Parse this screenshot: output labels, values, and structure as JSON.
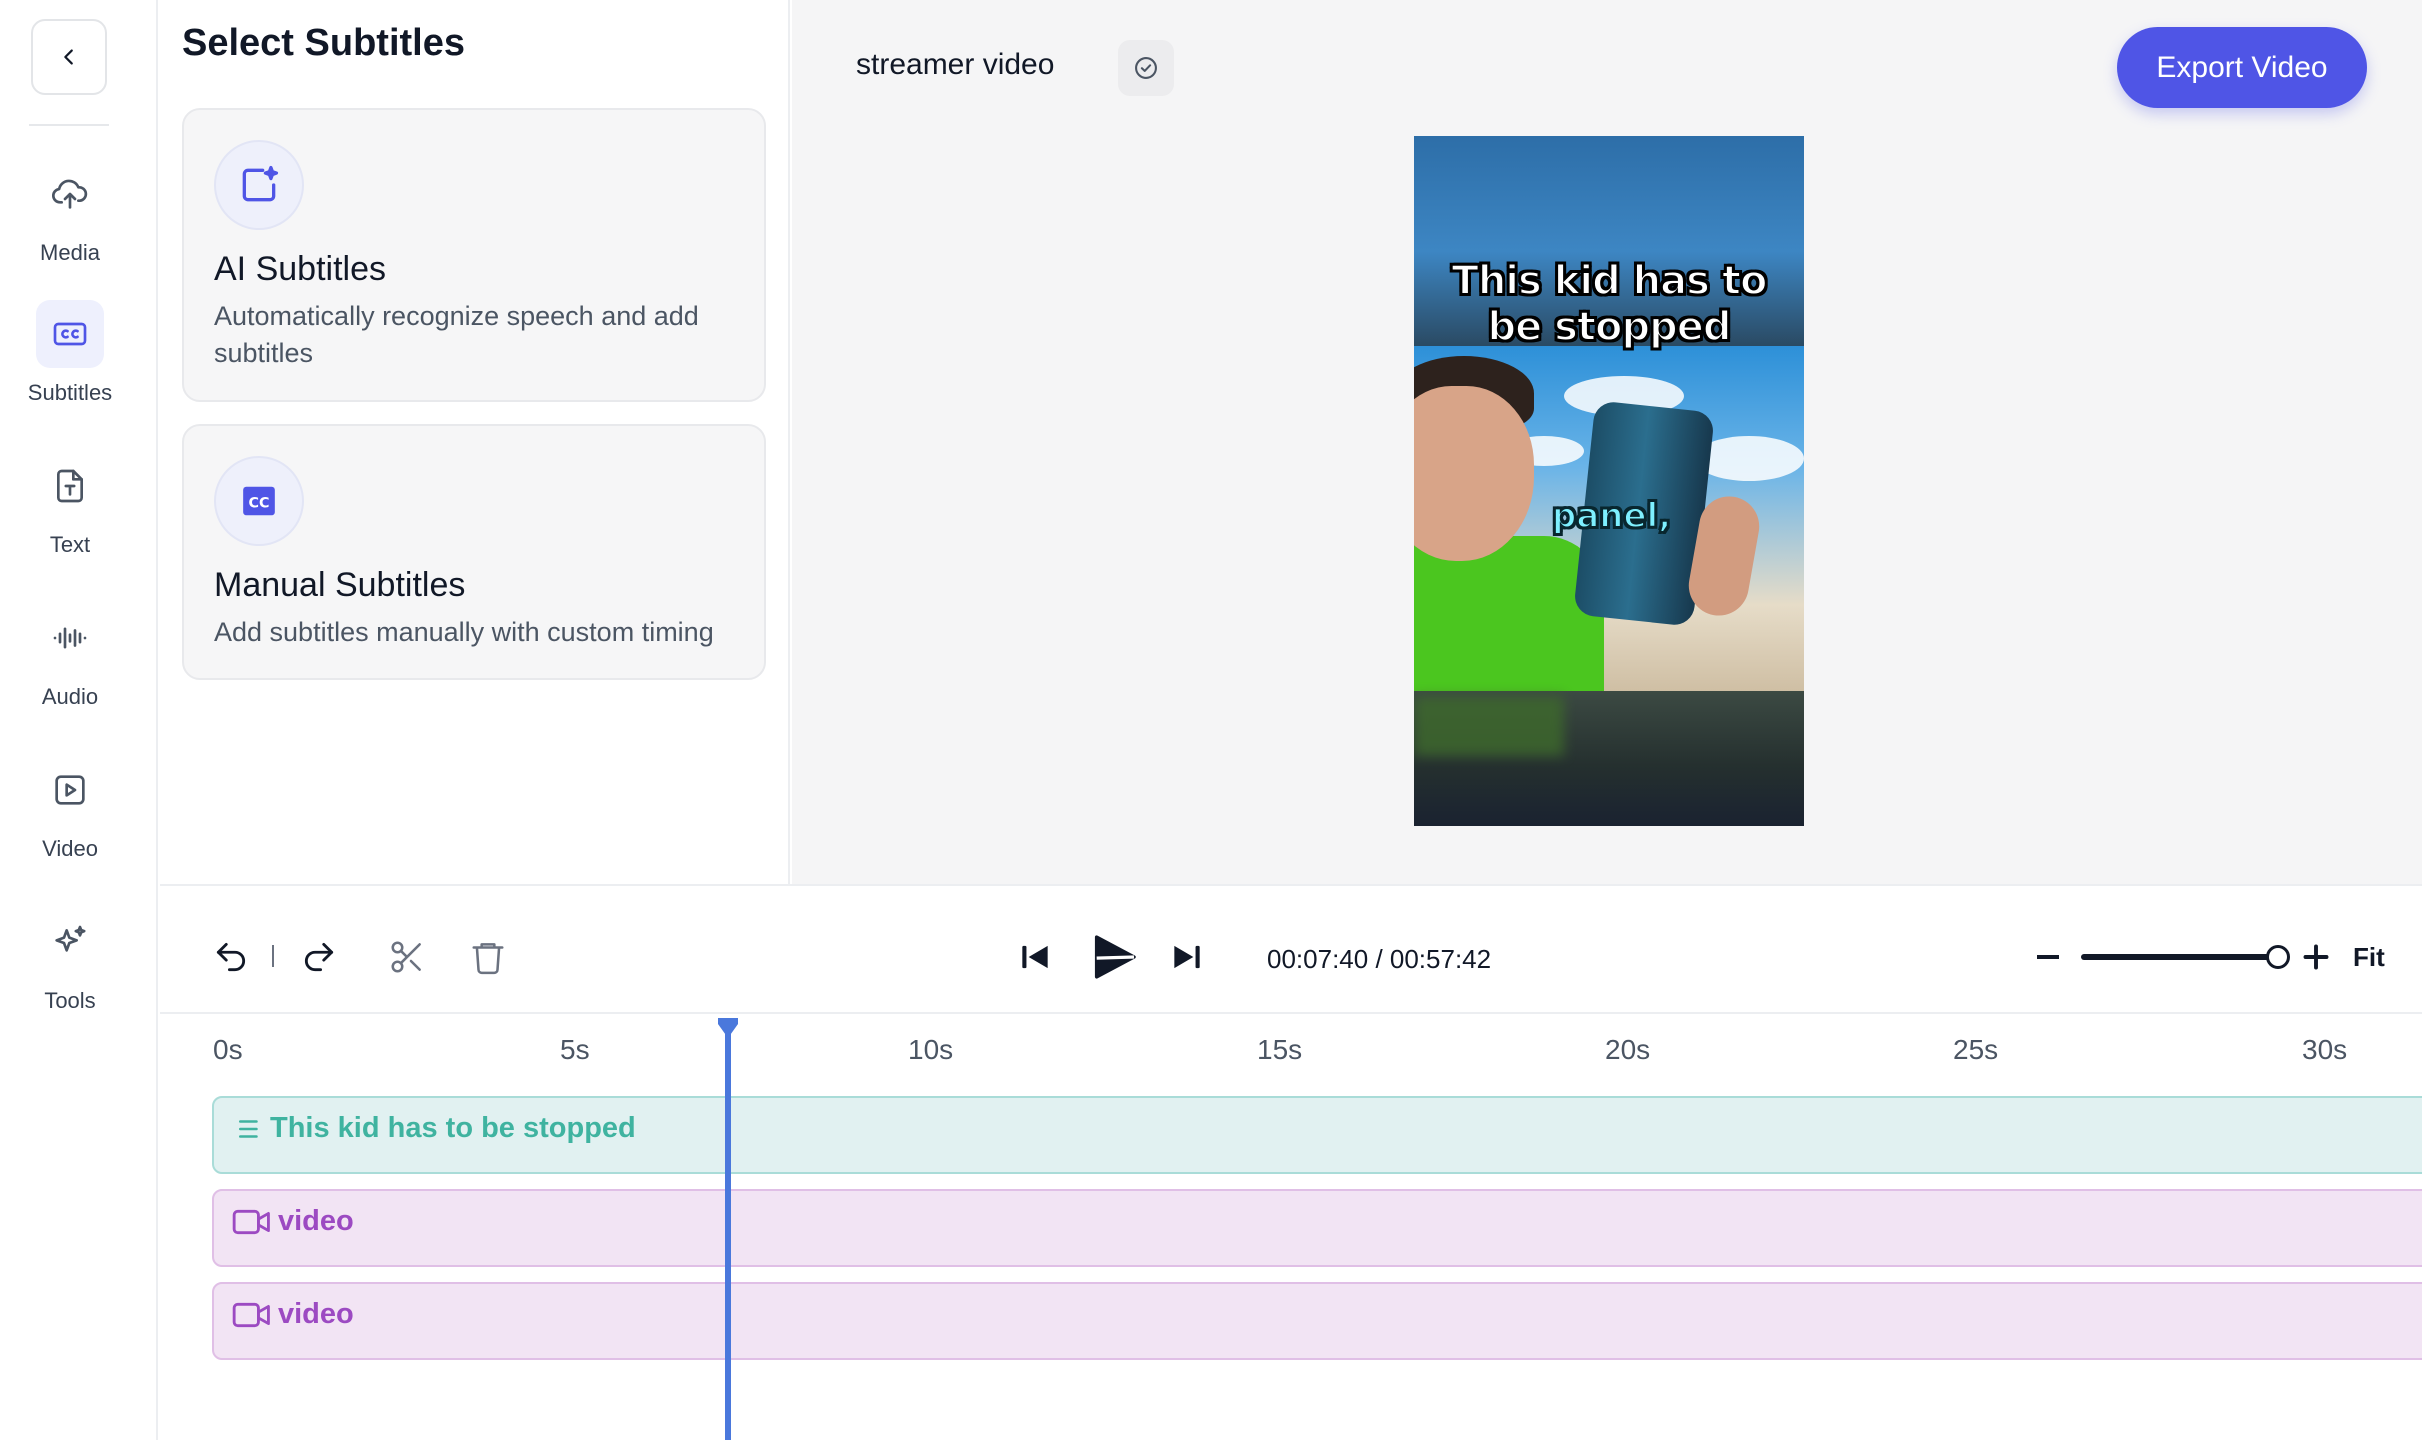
{
  "sidebar": {
    "back_icon": "chevron-left-icon",
    "items": [
      {
        "label": "Media",
        "icon": "cloud-upload-icon",
        "active": false
      },
      {
        "label": "Subtitles",
        "icon": "closed-captions-icon",
        "active": true
      },
      {
        "label": "Text",
        "icon": "text-file-icon",
        "active": false
      },
      {
        "label": "Audio",
        "icon": "audio-waveform-icon",
        "active": false
      },
      {
        "label": "Video",
        "icon": "video-play-icon",
        "active": false
      },
      {
        "label": "Tools",
        "icon": "sparkles-icon",
        "active": false
      }
    ]
  },
  "panel": {
    "title": "Select Subtitles",
    "options": [
      {
        "title": "AI Subtitles",
        "description": "Automatically recognize speech and add subtitles",
        "icon": "ai-sparkle-frame-icon"
      },
      {
        "title": "Manual Subtitles",
        "description": "Add subtitles manually with custom timing",
        "icon": "cc-badge-icon"
      }
    ]
  },
  "header": {
    "project_name": "streamer video",
    "saved_icon": "check-circle-icon",
    "export_label": "Export Video"
  },
  "preview": {
    "caption_line1": "This kid has to",
    "caption_line2": "be stopped",
    "caption_word": "panel,"
  },
  "playback": {
    "current_time": "00:07:40",
    "total_time": "00:57:42",
    "time_separator": " / ",
    "zoom_fit_label": "Fit",
    "zoom_level": 0.95
  },
  "timeline": {
    "ruler": [
      "0s",
      "5s",
      "10s",
      "15s",
      "20s",
      "25s",
      "30s"
    ],
    "playhead_seconds": 7.4,
    "tracks": [
      {
        "type": "subtitle",
        "label": "This kid has to be stopped",
        "icon": "list-lines-icon"
      },
      {
        "type": "video",
        "label": "video",
        "icon": "video-camera-icon"
      },
      {
        "type": "video",
        "label": "video",
        "icon": "video-camera-icon"
      }
    ]
  },
  "colors": {
    "accent": "#4f55e6",
    "subtitle_track": "#e1f1f1",
    "subtitle_text": "#3fb3a0",
    "video_track": "#f2e4f4",
    "video_text": "#9c4ac2",
    "playhead": "#4a78dc"
  }
}
